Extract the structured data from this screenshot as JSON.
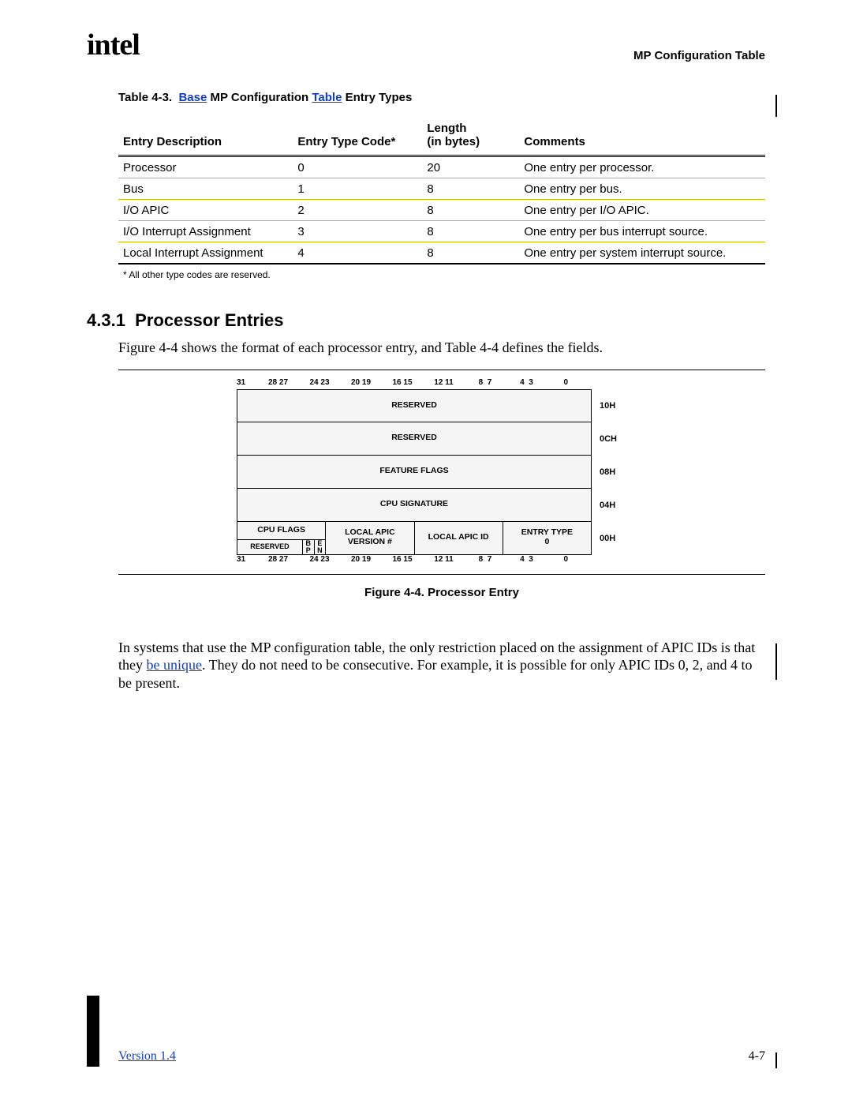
{
  "header": {
    "logo_text": "intel",
    "section_title": "MP Configuration Table"
  },
  "table_caption": {
    "label": "Table 4-3.",
    "link1": "Base",
    "mid": " MP Configuration ",
    "link2": "Table",
    "tail": " Entry Types"
  },
  "table": {
    "headers": {
      "c0": "Entry Description",
      "c1": "Entry Type Code*",
      "c2_top": "Length",
      "c2_bot": "(in bytes)",
      "c3": "Comments"
    },
    "rows": [
      {
        "desc": "Processor",
        "code": "0",
        "len": "20",
        "comment": "One entry per processor."
      },
      {
        "desc": "Bus",
        "code": "1",
        "len": "8",
        "comment": "One entry per bus."
      },
      {
        "desc": "I/O APIC",
        "code": "2",
        "len": "8",
        "comment": "One entry per I/O APIC."
      },
      {
        "desc": "I/O Interrupt Assignment",
        "code": "3",
        "len": "8",
        "comment": "One entry per bus interrupt source."
      },
      {
        "desc": "Local Interrupt Assignment",
        "code": "4",
        "len": "8",
        "comment": "One entry per system interrupt source."
      }
    ]
  },
  "table_note": "*  All other type codes are reserved.",
  "section": {
    "heading_num": "4.3.1",
    "heading_text": "Processor Entries",
    "para1": "Figure 4-4 shows the format of each processor entry, and Table 4-4 defines the fields."
  },
  "figure": {
    "bit_labels_top": [
      "31",
      "28 27",
      "24 23",
      "20 19",
      "16 15",
      "12 11",
      "8  7",
      "4  3",
      "0"
    ],
    "rows": {
      "r10H": {
        "cells": [
          "RESERVED"
        ],
        "offset": "10H"
      },
      "r0CH": {
        "cells": [
          "RESERVED"
        ],
        "offset": "0CH"
      },
      "r08H": {
        "cells": [
          "FEATURE FLAGS"
        ],
        "offset": "08H"
      },
      "r04H": {
        "cells": [
          "CPU SIGNATURE"
        ],
        "offset": "04H"
      },
      "r00H": {
        "cpu_flags": "CPU FLAGS",
        "cpu_flags_sub": [
          "RESERVED",
          "B\nP",
          "E\nN"
        ],
        "local_apic_ver": "LOCAL APIC\nVERSION #",
        "local_apic_id": "LOCAL APIC ID",
        "entry_type": "ENTRY TYPE\n0",
        "offset": "00H"
      }
    },
    "bit_labels_bot": [
      "31",
      "28 27",
      "24 23",
      "20 19",
      "16 15",
      "12 11",
      "8  7",
      "4  3",
      "0"
    ],
    "caption": "Figure 4-4.  Processor Entry"
  },
  "para2_parts": {
    "a": "In systems that use the MP configuration table, the only restriction placed on the assignment of APIC IDs is that they ",
    "link": "be unique",
    "b": ".  They do not need to be consecutive.  For example, it is possible for only APIC IDs 0, 2, and 4 to be present."
  },
  "footer": {
    "left": "Version 1.4",
    "right": "4-7"
  }
}
